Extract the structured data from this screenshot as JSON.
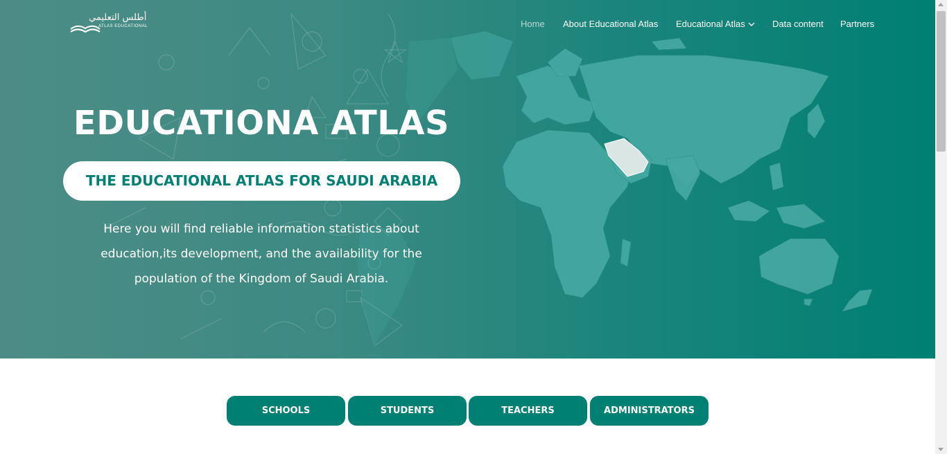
{
  "logo": {
    "arabic": "أطلس التعليمي",
    "english": "ATLAS EDUCATIONAL"
  },
  "nav": {
    "items": [
      {
        "label": "Home",
        "active": true
      },
      {
        "label": "About Educational Atlas"
      },
      {
        "label": "Educational Atlas",
        "has_dropdown": true
      },
      {
        "label": "Data content"
      },
      {
        "label": "Partners"
      }
    ]
  },
  "hero": {
    "title": "EDUCATIONA ATLAS",
    "subtitle": "THE EDUCATIONAL ATLAS FOR SAUDI ARABIA",
    "description": "Here you will find reliable information statistics about education,its development, and the availability for the population of the Kingdom of Saudi Arabia."
  },
  "tabs": [
    {
      "label": "SCHOOLS"
    },
    {
      "label": "STUDENTS"
    },
    {
      "label": "TEACHERS"
    },
    {
      "label": "ADMINISTRATORS"
    }
  ],
  "colors": {
    "primary": "#007f73",
    "hero_left": "#4c8c86",
    "map_land": "#46aaa2",
    "highlight_country": "#d9e6e4",
    "active_nav": "#b9dad6"
  }
}
